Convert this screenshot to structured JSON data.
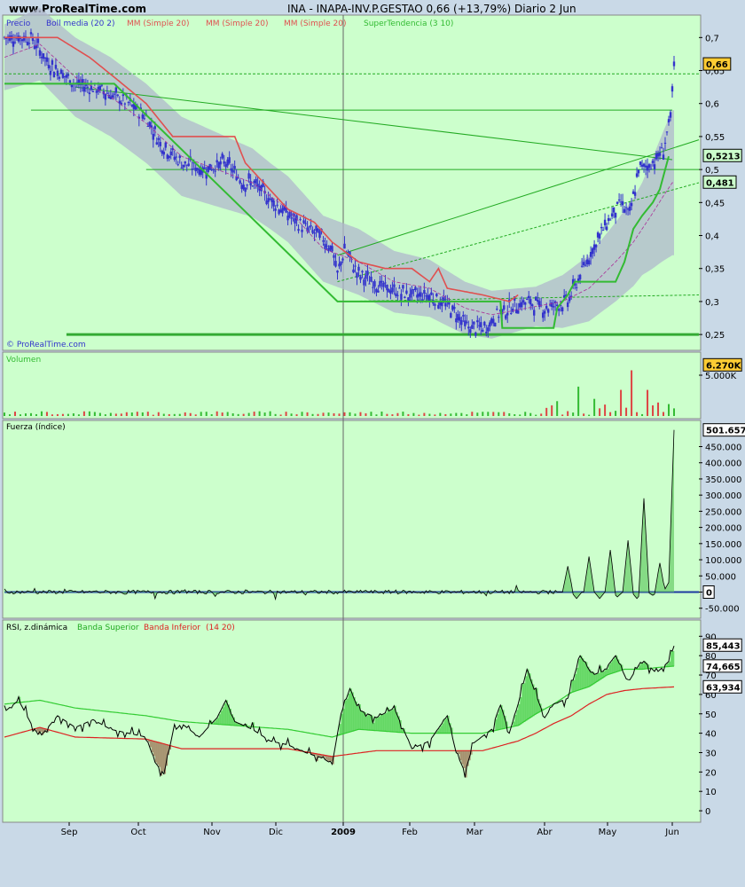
{
  "header": {
    "site": "www.ProRealTime.com",
    "title": "INA - INAPA-INV.P.GESTAO    0,66 (+13,79%)    Diario  2 Jun"
  },
  "watermark": "© ProRealTime.com",
  "colors": {
    "panel_bg": "#ccffcc",
    "page_bg": "#c9d9e7",
    "candle": "#3333cc",
    "boll": "#b0b8cc",
    "mm": "#e05050",
    "st": "#33bb33",
    "rsi": "#000000",
    "band_sup": "#33cc33",
    "band_inf": "#dd2222"
  },
  "chart_data": [
    {
      "type": "candlestick",
      "panel": "price",
      "legend": [
        "Precio",
        "Boll media (20 2)",
        "MM (Simple 20)",
        "MM (Simple 20)",
        "MM (Simple 20)",
        "SuperTendencia (3 10)"
      ],
      "yticks": [
        "0,7",
        "0,65",
        "0,6",
        "0,55",
        "0,5",
        "0,45",
        "0,4",
        "0,35",
        "0,3",
        "0,25"
      ],
      "ylim": [
        0.23,
        0.73
      ],
      "xticks": [
        "Sep",
        "Oct",
        "Nov",
        "Dic",
        "2009",
        "Feb",
        "Mar",
        "Abr",
        "May",
        "Jun"
      ],
      "last_value": "0,66",
      "markers": [
        {
          "label": "0,5213",
          "value": 0.5213
        },
        {
          "label": "0,481",
          "value": 0.481
        }
      ],
      "close_path": [
        [
          0,
          0.7
        ],
        [
          15,
          0.7
        ],
        [
          25,
          0.66
        ],
        [
          40,
          0.63
        ],
        [
          55,
          0.62
        ],
        [
          70,
          0.6
        ],
        [
          80,
          0.58
        ],
        [
          88,
          0.54
        ],
        [
          100,
          0.51
        ],
        [
          112,
          0.5
        ],
        [
          125,
          0.51
        ],
        [
          135,
          0.48
        ],
        [
          140,
          0.48
        ],
        [
          152,
          0.45
        ],
        [
          165,
          0.42
        ],
        [
          178,
          0.4
        ],
        [
          185,
          0.38
        ],
        [
          188,
          0.34
        ],
        [
          192,
          0.38
        ],
        [
          200,
          0.34
        ],
        [
          215,
          0.32
        ],
        [
          228,
          0.31
        ],
        [
          240,
          0.31
        ],
        [
          252,
          0.29
        ],
        [
          262,
          0.26
        ],
        [
          272,
          0.26
        ],
        [
          278,
          0.28
        ],
        [
          285,
          0.29
        ],
        [
          295,
          0.3
        ],
        [
          305,
          0.29
        ],
        [
          318,
          0.3
        ],
        [
          325,
          0.34
        ],
        [
          332,
          0.38
        ],
        [
          340,
          0.42
        ],
        [
          348,
          0.45
        ],
        [
          353,
          0.43
        ],
        [
          358,
          0.5
        ],
        [
          366,
          0.51
        ],
        [
          372,
          0.53
        ],
        [
          376,
          0.58
        ],
        [
          378,
          0.65
        ]
      ],
      "supertendencia": [
        [
          0,
          0.63
        ],
        [
          8,
          0.63
        ],
        [
          60,
          0.63
        ],
        [
          62,
          0.63
        ],
        [
          188,
          0.3
        ],
        [
          280,
          0.3
        ],
        [
          281,
          0.26
        ],
        [
          310,
          0.26
        ],
        [
          312,
          0.29
        ],
        [
          318,
          0.31
        ],
        [
          322,
          0.33
        ],
        [
          345,
          0.33
        ],
        [
          350,
          0.36
        ],
        [
          355,
          0.41
        ],
        [
          360,
          0.43
        ],
        [
          366,
          0.45
        ],
        [
          370,
          0.47
        ],
        [
          375,
          0.52
        ]
      ],
      "mm": [
        [
          0,
          0.7
        ],
        [
          10,
          0.7
        ],
        [
          30,
          0.7
        ],
        [
          48,
          0.67
        ],
        [
          62,
          0.64
        ],
        [
          80,
          0.6
        ],
        [
          95,
          0.55
        ],
        [
          130,
          0.55
        ],
        [
          136,
          0.51
        ],
        [
          160,
          0.44
        ],
        [
          175,
          0.42
        ],
        [
          185,
          0.39
        ],
        [
          200,
          0.36
        ],
        [
          215,
          0.35
        ],
        [
          230,
          0.35
        ],
        [
          240,
          0.33
        ],
        [
          245,
          0.35
        ],
        [
          250,
          0.32
        ],
        [
          270,
          0.31
        ],
        [
          285,
          0.3
        ],
        [
          290,
          0.31
        ]
      ],
      "boll_mid": [
        [
          0,
          0.67
        ],
        [
          20,
          0.69
        ],
        [
          40,
          0.64
        ],
        [
          60,
          0.61
        ],
        [
          80,
          0.57
        ],
        [
          100,
          0.52
        ],
        [
          120,
          0.5
        ],
        [
          140,
          0.48
        ],
        [
          160,
          0.44
        ],
        [
          180,
          0.38
        ],
        [
          200,
          0.36
        ],
        [
          220,
          0.33
        ],
        [
          240,
          0.32
        ],
        [
          260,
          0.29
        ],
        [
          275,
          0.28
        ],
        [
          295,
          0.29
        ],
        [
          315,
          0.3
        ],
        [
          330,
          0.32
        ],
        [
          345,
          0.36
        ],
        [
          355,
          0.39
        ],
        [
          365,
          0.43
        ],
        [
          372,
          0.46
        ],
        [
          377,
          0.48
        ]
      ],
      "boll_width": [
        [
          0,
          0.05
        ],
        [
          40,
          0.06
        ],
        [
          100,
          0.06
        ],
        [
          150,
          0.05
        ],
        [
          200,
          0.05
        ],
        [
          260,
          0.04
        ],
        [
          300,
          0.03
        ],
        [
          330,
          0.05
        ],
        [
          360,
          0.07
        ],
        [
          377,
          0.11
        ]
      ],
      "trendlines": [
        {
          "style": "solid",
          "p1": [
            15,
            0.59
          ],
          "p2": [
            377,
            0.59
          ]
        },
        {
          "style": "solid",
          "p1": [
            40,
            0.625
          ],
          "p2": [
            377,
            0.515
          ]
        },
        {
          "style": "solid",
          "p1": [
            188,
            0.37
          ],
          "p2": [
            392,
            0.545
          ]
        },
        {
          "style": "dashed",
          "p1": [
            188,
            0.33
          ],
          "p2": [
            392,
            0.48
          ]
        },
        {
          "style": "solid",
          "p1": [
            80,
            0.5
          ],
          "p2": [
            392,
            0.5
          ]
        },
        {
          "style": "dashed",
          "p1": [
            0,
            0.645
          ],
          "p2": [
            392,
            0.645
          ]
        },
        {
          "style": "dashed",
          "p1": [
            188,
            0.3
          ],
          "p2": [
            392,
            0.31
          ]
        },
        {
          "style": "thick",
          "p1": [
            35,
            0.25
          ],
          "p2": [
            392,
            0.25
          ]
        }
      ]
    },
    {
      "type": "bar",
      "panel": "volume",
      "label": "Volumen",
      "yticks": [
        "5.000K"
      ],
      "last_value": "6.270K",
      "ylim": [
        0,
        7500000
      ],
      "spikes": [
        [
          310,
          1300000.0
        ],
        [
          318,
          2500000.0
        ],
        [
          325,
          3600000.0
        ],
        [
          332,
          2100000.0
        ],
        [
          336,
          1800000.0
        ],
        [
          344,
          5700000.0
        ],
        [
          349,
          3200000.0
        ],
        [
          355,
          5600000.0
        ],
        [
          362,
          3200000.0
        ],
        [
          369,
          4900000.0
        ],
        [
          374,
          3200000.0
        ],
        [
          377,
          6270000.0
        ]
      ]
    },
    {
      "type": "line",
      "panel": "fuerza",
      "label": "Fuerza (índice)",
      "yticks": [
        "450.000",
        "400.000",
        "350.000",
        "300.000",
        "250.000",
        "200.000",
        "150.000",
        "100.000",
        "50.000",
        "0",
        "-50.000"
      ],
      "ylim": [
        -70000,
        520000
      ],
      "last_value": "501.657",
      "zero_label": "0",
      "peaks": [
        [
          318,
          80000
        ],
        [
          323,
          -20000
        ],
        [
          330,
          110000
        ],
        [
          336,
          -20000
        ],
        [
          342,
          130000
        ],
        [
          346,
          -15000
        ],
        [
          352,
          160000
        ],
        [
          357,
          -20000
        ],
        [
          361,
          290000
        ],
        [
          366,
          -10000
        ],
        [
          370,
          90000
        ],
        [
          375,
          30000
        ],
        [
          378,
          501657
        ]
      ]
    },
    {
      "type": "line",
      "panel": "rsi",
      "legend": [
        "RSI, z.dinámica",
        "Banda Superior",
        "Banda Inferior",
        "(14 20)"
      ],
      "yticks": [
        "90",
        "80",
        "70",
        "60",
        "50",
        "40",
        "30",
        "20",
        "10",
        "0"
      ],
      "ylim": [
        -5,
        97
      ],
      "values": {
        "rsi": "85,443",
        "banda_superior": "74,665",
        "banda_inferior": "63,934"
      },
      "rsi": [
        [
          0,
          51
        ],
        [
          8,
          57
        ],
        [
          15,
          45
        ],
        [
          20,
          38
        ],
        [
          30,
          49
        ],
        [
          40,
          43
        ],
        [
          50,
          47
        ],
        [
          60,
          42
        ],
        [
          70,
          40
        ],
        [
          80,
          38
        ],
        [
          85,
          25
        ],
        [
          90,
          19
        ],
        [
          95,
          40
        ],
        [
          100,
          45
        ],
        [
          110,
          38
        ],
        [
          120,
          48
        ],
        [
          125,
          57
        ],
        [
          130,
          46
        ],
        [
          140,
          42
        ],
        [
          150,
          36
        ],
        [
          160,
          34
        ],
        [
          170,
          30
        ],
        [
          180,
          27
        ],
        [
          185,
          24
        ],
        [
          190,
          50
        ],
        [
          195,
          63
        ],
        [
          200,
          52
        ],
        [
          210,
          48
        ],
        [
          220,
          53
        ],
        [
          230,
          32
        ],
        [
          240,
          36
        ],
        [
          250,
          49
        ],
        [
          255,
          30
        ],
        [
          260,
          20
        ],
        [
          265,
          35
        ],
        [
          275,
          42
        ],
        [
          280,
          55
        ],
        [
          285,
          40
        ],
        [
          290,
          55
        ],
        [
          295,
          73
        ],
        [
          300,
          60
        ],
        [
          305,
          48
        ],
        [
          310,
          55
        ],
        [
          318,
          58
        ],
        [
          325,
          80
        ],
        [
          332,
          70
        ],
        [
          338,
          72
        ],
        [
          345,
          80
        ],
        [
          352,
          66
        ],
        [
          360,
          78
        ],
        [
          368,
          71
        ],
        [
          375,
          77
        ],
        [
          378,
          85
        ]
      ],
      "band_sup": [
        [
          0,
          55
        ],
        [
          20,
          57
        ],
        [
          40,
          53
        ],
        [
          80,
          49
        ],
        [
          100,
          46
        ],
        [
          130,
          44
        ],
        [
          160,
          42
        ],
        [
          185,
          38
        ],
        [
          200,
          42
        ],
        [
          230,
          40
        ],
        [
          250,
          40
        ],
        [
          270,
          40
        ],
        [
          290,
          44
        ],
        [
          300,
          50
        ],
        [
          310,
          55
        ],
        [
          320,
          61
        ],
        [
          330,
          64
        ],
        [
          340,
          70
        ],
        [
          350,
          73
        ],
        [
          360,
          73
        ],
        [
          370,
          74
        ],
        [
          378,
          74.6
        ]
      ],
      "band_inf": [
        [
          0,
          38
        ],
        [
          20,
          43
        ],
        [
          40,
          38
        ],
        [
          80,
          37
        ],
        [
          100,
          32
        ],
        [
          130,
          32
        ],
        [
          160,
          32
        ],
        [
          185,
          28
        ],
        [
          210,
          31
        ],
        [
          240,
          31
        ],
        [
          270,
          31
        ],
        [
          290,
          36
        ],
        [
          300,
          40
        ],
        [
          310,
          45
        ],
        [
          320,
          49
        ],
        [
          330,
          55
        ],
        [
          340,
          60
        ],
        [
          350,
          62
        ],
        [
          360,
          63
        ],
        [
          370,
          63.5
        ],
        [
          378,
          63.9
        ]
      ]
    }
  ]
}
